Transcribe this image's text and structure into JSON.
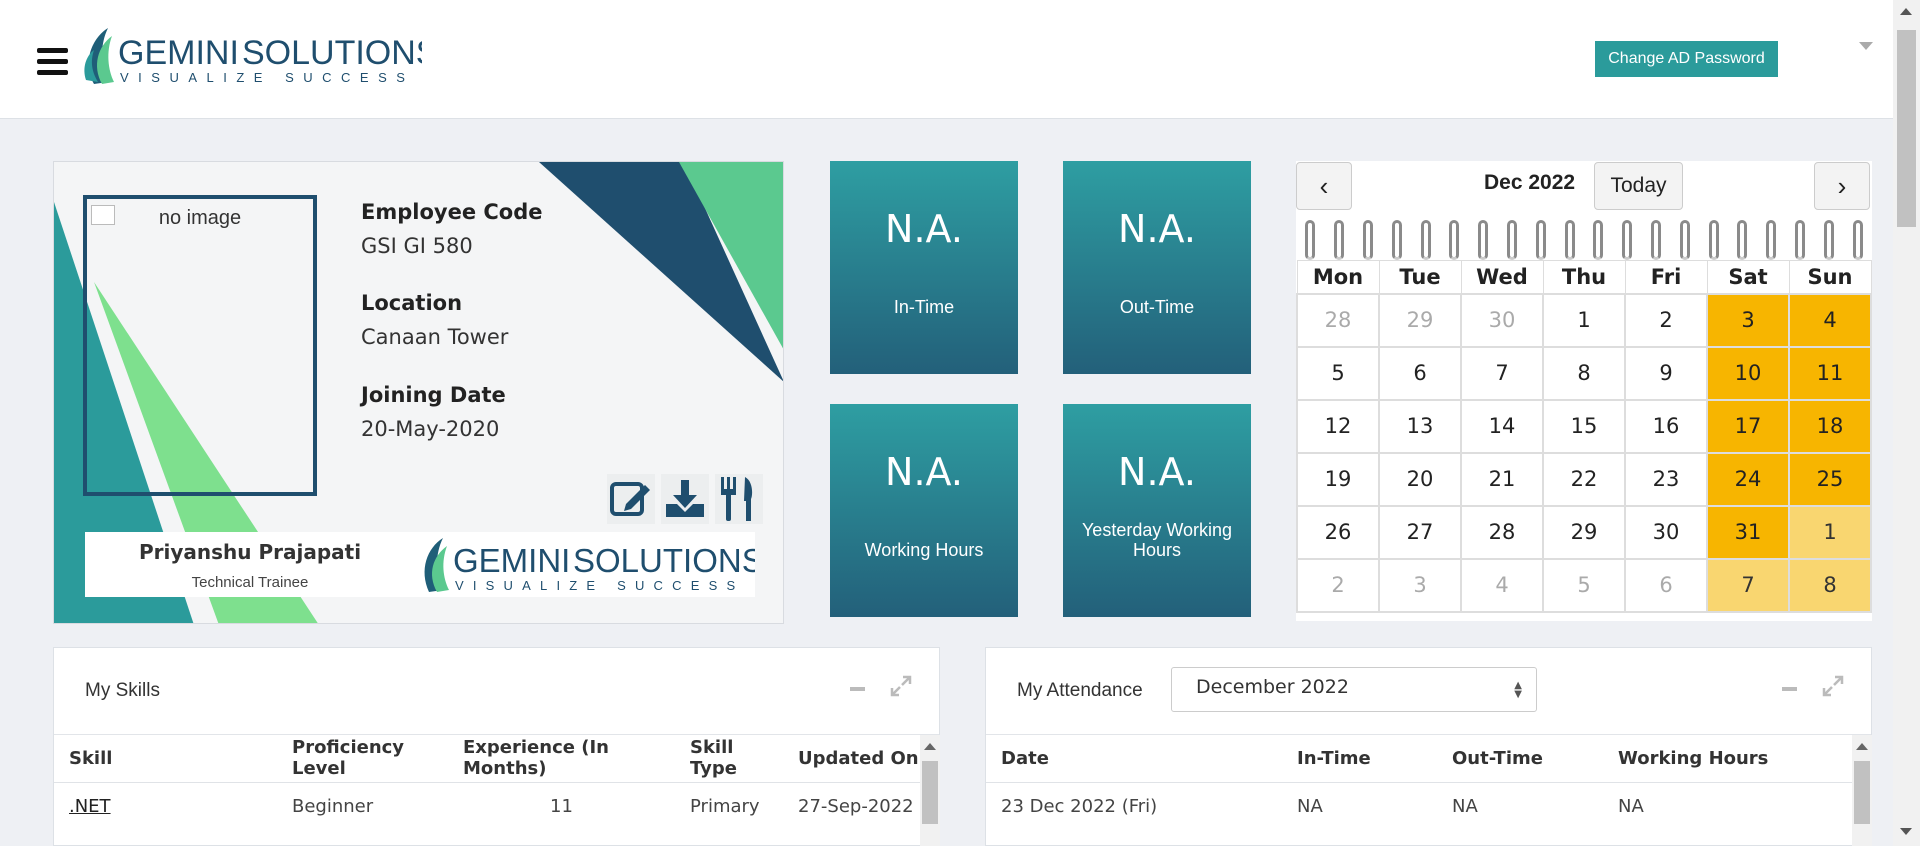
{
  "header": {
    "logo_main": "GEMINI",
    "logo_sub": "SOLUTIONS",
    "logo_tagline": "VISUALIZE SUCCESS",
    "change_password_label": "Change AD Password"
  },
  "profile": {
    "photo_alt": "no image",
    "employee_code_label": "Employee Code",
    "employee_code": "GSI GI 580",
    "location_label": "Location",
    "location": "Canaan Tower",
    "joining_date_label": "Joining Date",
    "joining_date": "20-May-2020",
    "name": "Priyanshu Prajapati",
    "role": "Technical Trainee",
    "icons": [
      "edit-icon",
      "download-icon",
      "fork-knife-icon"
    ]
  },
  "stats": [
    {
      "value": "N.A.",
      "label": "In-Time"
    },
    {
      "value": "N.A.",
      "label": "Out-Time"
    },
    {
      "value": "N.A.",
      "label": "Working Hours"
    },
    {
      "value": "N.A.",
      "label": "Yesterday Working Hours"
    }
  ],
  "calendar": {
    "prev": "‹",
    "next": "›",
    "month": "Dec 2022",
    "today_label": "Today",
    "weekdays": [
      "Mon",
      "Tue",
      "Wed",
      "Thu",
      "Fri",
      "Sat",
      "Sun"
    ],
    "weeks": [
      [
        "28",
        "29",
        "30",
        "1",
        "2",
        "3",
        "4"
      ],
      [
        "5",
        "6",
        "7",
        "8",
        "9",
        "10",
        "11"
      ],
      [
        "12",
        "13",
        "14",
        "15",
        "16",
        "17",
        "18"
      ],
      [
        "19",
        "20",
        "21",
        "22",
        "23",
        "24",
        "25"
      ],
      [
        "26",
        "27",
        "28",
        "29",
        "30",
        "31",
        "1"
      ],
      [
        "2",
        "3",
        "4",
        "5",
        "6",
        "7",
        "8"
      ]
    ],
    "weekend_color": "#f7b500",
    "other_month_weekend_color": "#f9d670"
  },
  "skills": {
    "title": "My Skills",
    "columns": [
      "Skill",
      "Proficiency Level",
      "Experience (In Months)",
      "Skill Type",
      "Updated On"
    ],
    "rows": [
      [
        ".NET",
        "Beginner",
        "11",
        "Primary",
        "27-Sep-2022"
      ]
    ]
  },
  "attendance": {
    "title": "My Attendance",
    "month_selected": "December 2022",
    "columns": [
      "Date",
      "In-Time",
      "Out-Time",
      "Working Hours"
    ],
    "rows": [
      [
        "23 Dec 2022 (Fri)",
        "NA",
        "NA",
        "NA"
      ]
    ]
  },
  "colors": {
    "teal": "#2b9b9b",
    "navy": "#1f4e6e",
    "green": "#5bc98f"
  }
}
